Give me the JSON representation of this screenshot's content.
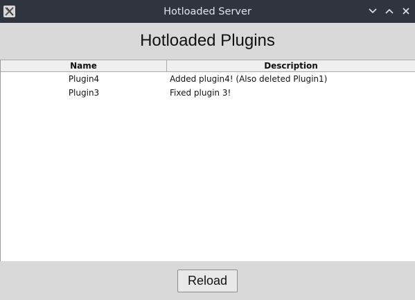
{
  "window": {
    "title": "Hotloaded Server",
    "controls": [
      "chevron-down-icon",
      "chevron-up-icon",
      "close-icon"
    ]
  },
  "heading": "Hotloaded Plugins",
  "table": {
    "columns": [
      "Name",
      "Description"
    ],
    "rows": [
      {
        "name": "Plugin4",
        "description": "Added plugin4! (Also deleted Plugin1)"
      },
      {
        "name": "Plugin3",
        "description": "Fixed plugin 3!"
      }
    ]
  },
  "reload_label": "Reload",
  "colors": {
    "titlebar": "#2f343f",
    "window_bg": "#d9d9d9",
    "table_bg": "#ffffff"
  }
}
